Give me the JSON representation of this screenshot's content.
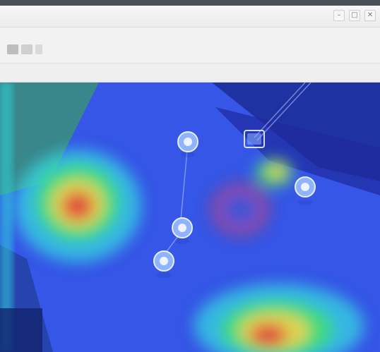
{
  "window": {
    "title": "",
    "controls": [
      "–",
      "□",
      "✕"
    ]
  },
  "toolbar": {
    "label": ""
  },
  "subbar": {
    "label": ""
  },
  "map": {
    "markers": [
      {
        "name": "marker-1"
      },
      {
        "name": "marker-2"
      },
      {
        "name": "marker-3"
      },
      {
        "name": "marker-4"
      }
    ]
  },
  "icons": {
    "pin": "location-pin-icon",
    "back": "back-icon",
    "refresh": "refresh-icon"
  },
  "colors": {
    "map_base": "#3556e6",
    "heat_hot": "#e0413b",
    "heat_warm": "#f2d34a",
    "heat_mid": "#3fe06a",
    "heat_cool": "#35d7e0",
    "toolbar": "#f2f2f2"
  }
}
